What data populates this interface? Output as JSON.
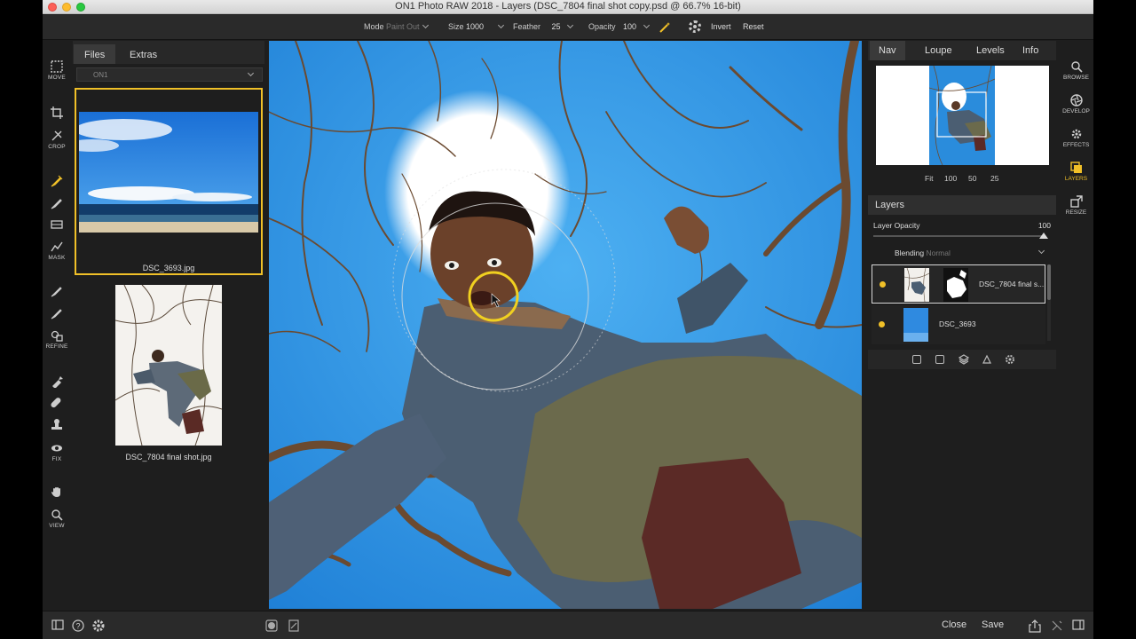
{
  "window": {
    "title": "ON1 Photo RAW 2018 - Layers (DSC_7804 final shot copy.psd @ 66.7% 16-bit)"
  },
  "options_bar": {
    "mode_label": "Mode",
    "mode_value": "Paint Out",
    "size_label": "Size",
    "size_value": "1000",
    "feather_label": "Feather",
    "feather_value": "25",
    "opacity_label": "Opacity",
    "opacity_value": "100",
    "invert_label": "Invert",
    "reset_label": "Reset"
  },
  "tool_rail": {
    "move": "MOVE",
    "crop": "CROP",
    "mask": "MASK",
    "refine": "REFINE",
    "fix": "FIX",
    "view": "VIEW"
  },
  "browser": {
    "tabs": [
      "Files",
      "Extras"
    ],
    "folder": "ON1",
    "thumbnails": [
      {
        "name": "DSC_3693.jpg",
        "selected": true
      },
      {
        "name": "DSC_7804 final shot.jpg",
        "selected": false
      }
    ]
  },
  "nav_panel": {
    "tabs": [
      "Nav",
      "Loupe",
      "Levels",
      "Info"
    ],
    "zoom_options": [
      "Fit",
      "100",
      "50",
      "25"
    ]
  },
  "layers_panel": {
    "title": "Layers",
    "opacity_label": "Layer Opacity",
    "opacity_value": "100",
    "blending_label": "Blending",
    "blending_value": "Normal",
    "layers": [
      {
        "name": "DSC_7804 final s...",
        "selected": true
      },
      {
        "name": "DSC_3693",
        "selected": false
      }
    ]
  },
  "module_rail": {
    "browse": "BROWSE",
    "develop": "DEVELOP",
    "effects": "EFFECTS",
    "layers": "LAYERS",
    "resize": "RESIZE"
  },
  "bottom_bar": {
    "close_label": "Close",
    "save_label": "Save"
  },
  "colors": {
    "accent": "#f0c028",
    "panel_bg": "#1e1e1e",
    "sky": "#2a8cdc"
  }
}
